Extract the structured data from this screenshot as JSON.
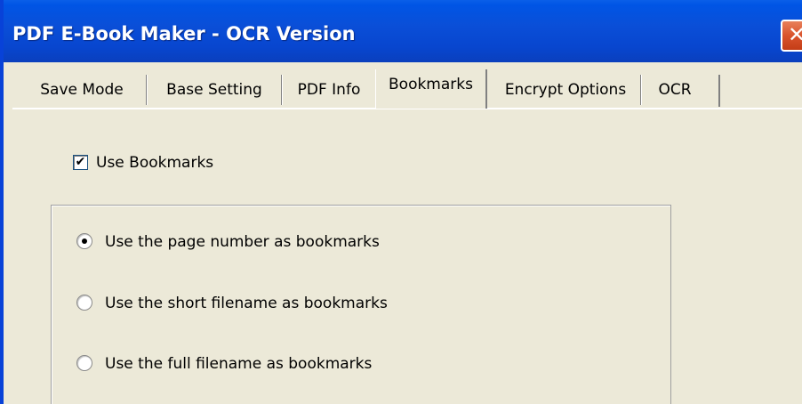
{
  "window": {
    "title": "PDF E-Book Maker - OCR Version",
    "close_glyph": "✕"
  },
  "tabs": [
    {
      "label": "Save Mode",
      "active": false
    },
    {
      "label": "Base Setting",
      "active": false
    },
    {
      "label": "PDF Info",
      "active": false
    },
    {
      "label": "Bookmarks",
      "active": true
    },
    {
      "label": "Encrypt Options",
      "active": false
    },
    {
      "label": "OCR",
      "active": false
    }
  ],
  "bookmarks": {
    "use_bookmarks_label": "Use Bookmarks",
    "use_bookmarks_checked": true,
    "check_glyph": "✔",
    "options": [
      {
        "label": "Use the page number as bookmarks",
        "selected": true
      },
      {
        "label": "Use the short filename as bookmarks",
        "selected": false
      },
      {
        "label": "Use the full filename as bookmarks",
        "selected": false
      }
    ]
  },
  "colors": {
    "titlebar": "#0a4fd8",
    "dialog_bg": "#ece9d8",
    "close_button": "#d9532c"
  }
}
